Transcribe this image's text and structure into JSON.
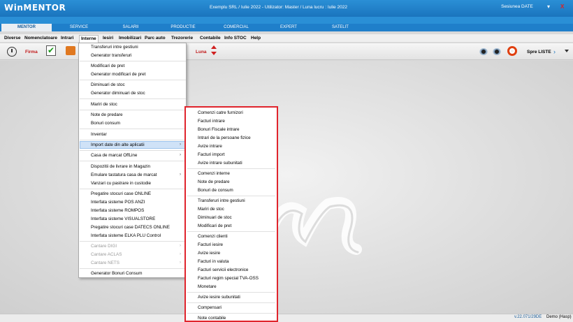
{
  "app": {
    "logo": "WinMENTOR",
    "title": "Exemplu SRL / Iulie 2022 - Utilizator: Master / Luna lucru : Iulie 2022",
    "session_label": "Sesiunea DATE",
    "minimize_label": "▾",
    "close_label": "X"
  },
  "modules": [
    {
      "label": "MENTOR",
      "active": true
    },
    {
      "label": "SERVICE",
      "active": false
    },
    {
      "label": "SALARII",
      "active": false
    },
    {
      "label": "PRODUCTIE",
      "active": false
    },
    {
      "label": "COMERCIAL",
      "active": false
    },
    {
      "label": "EXPERT",
      "active": false
    },
    {
      "label": "SATELIT",
      "active": false
    }
  ],
  "menubar": [
    {
      "label": "Diverse"
    },
    {
      "label": "Nomenclatoare"
    },
    {
      "label": "Intrari"
    },
    {
      "label": "Interne",
      "open": true
    },
    {
      "label": "Iesiri"
    },
    {
      "label": "Imobilizari"
    },
    {
      "label": "Parc auto"
    },
    {
      "label": "Trezorerie"
    },
    {
      "label": "Contabile"
    },
    {
      "label": "Info STOC"
    },
    {
      "label": "Help"
    }
  ],
  "toolbar": {
    "firma_label": "Firma",
    "luna_label": "Luna",
    "spre_label": "Spre LISTE"
  },
  "interne_menu": {
    "items": [
      {
        "label": "Transferuri intre gestiuni"
      },
      {
        "label": "Generator transferuri"
      },
      {
        "label": "Modificari de pret"
      },
      {
        "label": "Generator modificari de pret"
      },
      {
        "label": "Diminuari de stoc"
      },
      {
        "label": "Generator diminuari de stoc"
      },
      {
        "label": "Mariri de stoc"
      },
      {
        "label": "Note de predare"
      },
      {
        "label": "Bonuri consum"
      },
      {
        "label": "Inventar"
      },
      {
        "label": "Import date din alte aplicatii",
        "submenu": true,
        "highlighted": true
      },
      {
        "label": "Casa de marcat OffLine",
        "submenu": true
      },
      {
        "label": "Dispozitii de livrare in Magazin"
      },
      {
        "label": "Emulare tastatura casa de marcat",
        "submenu": true
      },
      {
        "label": "Vanzari cu pastrare in custodie"
      },
      {
        "label": "Pregatire stocuri case ONLINE"
      },
      {
        "label": "Interfata sisteme POS ANZI"
      },
      {
        "label": "Interfata sisteme ROMPOS"
      },
      {
        "label": "Interfata sisteme VISUALSTORE"
      },
      {
        "label": "Pregatire stocuri case DATECS ONLINE"
      },
      {
        "label": "Interfata sisteme ELKA PLU Control"
      },
      {
        "label": "Cantare DIGI",
        "submenu": true,
        "disabled": true
      },
      {
        "label": "Cantare ACLAS",
        "submenu": true,
        "disabled": true
      },
      {
        "label": "Cantare NETS",
        "submenu": true,
        "disabled": true
      },
      {
        "label": "Generator Bonuri Consum"
      }
    ]
  },
  "import_submenu": {
    "items": [
      {
        "label": "Comenzi catre furnizori"
      },
      {
        "label": "Facturi intrare"
      },
      {
        "label": "Bonuri Fiscale intrare"
      },
      {
        "label": "Intrari de la persoane fizice"
      },
      {
        "label": "Avize intrare"
      },
      {
        "label": "Facturi import"
      },
      {
        "label": "Avize intrare subunitati"
      },
      {
        "label": "Comenzi interne"
      },
      {
        "label": "Note de predare"
      },
      {
        "label": "Bonuri de consum"
      },
      {
        "label": "Transferuri intre gestiuni"
      },
      {
        "label": "Mariri de stoc"
      },
      {
        "label": "Diminuari de stoc"
      },
      {
        "label": "Modificari de pret"
      },
      {
        "label": "Comenzi clienti"
      },
      {
        "label": "Facturi iesire"
      },
      {
        "label": "Avize iesire"
      },
      {
        "label": "Facturi in valuta"
      },
      {
        "label": "Facturi servicii electronice"
      },
      {
        "label": "Facturi regim special TVA-OSS"
      },
      {
        "label": "Monetare"
      },
      {
        "label": "Avize iesire subunitati"
      },
      {
        "label": "Compensari"
      },
      {
        "label": "Note contabile"
      }
    ]
  },
  "status": {
    "version": "v.22.071/29DE",
    "user": "Demo (Hasp)"
  },
  "colors": {
    "titlebar": "#1a74bd",
    "highlight": "#cfe2f7",
    "submenu_border": "#e0242c"
  }
}
